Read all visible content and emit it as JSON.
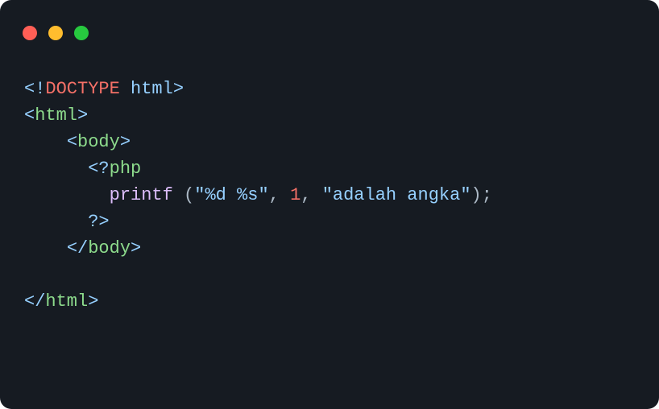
{
  "traffic": {
    "red": "close",
    "yellow": "minimize",
    "green": "zoom"
  },
  "code": {
    "doctype_open": "<!",
    "doctype_kw": "DOCTYPE",
    "doctype_name": " html",
    "doctype_close": ">",
    "html_open_l": "<",
    "html_tag": "html",
    "html_open_r": ">",
    "body_open_l": "<",
    "body_tag": "body",
    "body_open_r": ">",
    "php_open_l": "<?",
    "php_open_kw": "php",
    "printf": "printf",
    "space1": " ",
    "paren_l": "(",
    "str1": "\"%d %s\"",
    "comma1": ", ",
    "num1": "1",
    "comma2": ", ",
    "str2": "\"adalah angka\"",
    "paren_r": ")",
    "semi": ";",
    "php_close": "?>",
    "body_close_l": "</",
    "body_close_r": ">",
    "html_close_l": "</",
    "html_close_r": ">",
    "indent1": "    ",
    "indent2": "      ",
    "indent3": "        "
  }
}
